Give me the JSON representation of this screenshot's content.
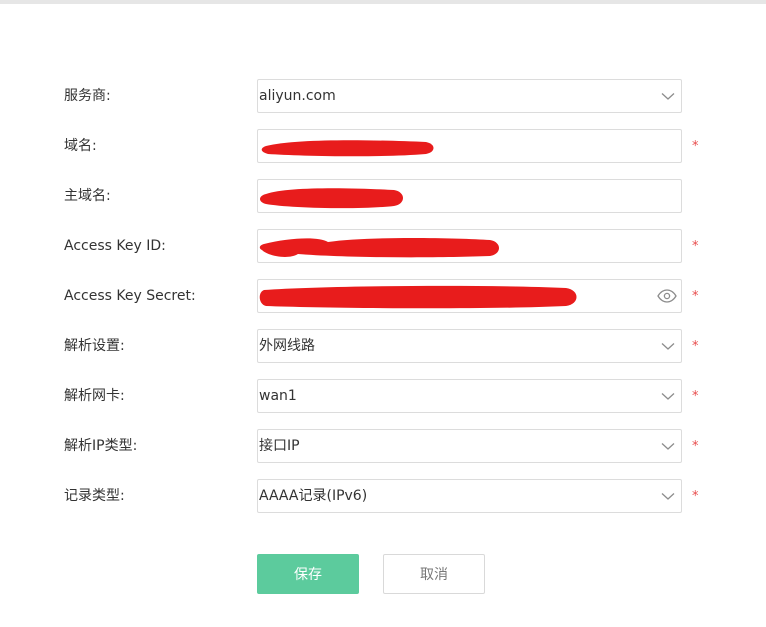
{
  "form": {
    "provider": {
      "label": "服务商:",
      "value": "aliyun.com",
      "required": ""
    },
    "domain": {
      "label": "域名:",
      "value": "",
      "required": "*"
    },
    "main_domain": {
      "label": "主域名:",
      "value": "",
      "required": ""
    },
    "access_key_id": {
      "label": "Access Key ID:",
      "value": "",
      "required": "*"
    },
    "access_key_secret": {
      "label": "Access Key Secret:",
      "value": "",
      "required": "*"
    },
    "resolve_setting": {
      "label": "解析设置:",
      "value": "外网线路",
      "required": "*"
    },
    "resolve_nic": {
      "label": "解析网卡:",
      "value": "wan1",
      "required": "*"
    },
    "resolve_ip_type": {
      "label": "解析IP类型:",
      "value": "接口IP",
      "required": "*"
    },
    "record_type": {
      "label": "记录类型:",
      "value": "AAAA记录(IPv6)",
      "required": "*"
    }
  },
  "buttons": {
    "save": "保存",
    "cancel": "取消"
  },
  "colors": {
    "primary": "#5ccb9d",
    "required": "#e84c4c",
    "redaction": "#e81c1c",
    "border": "#dcdcdc"
  },
  "icons": {
    "select": "chevron-down-icon",
    "password_toggle": "eye-icon"
  }
}
